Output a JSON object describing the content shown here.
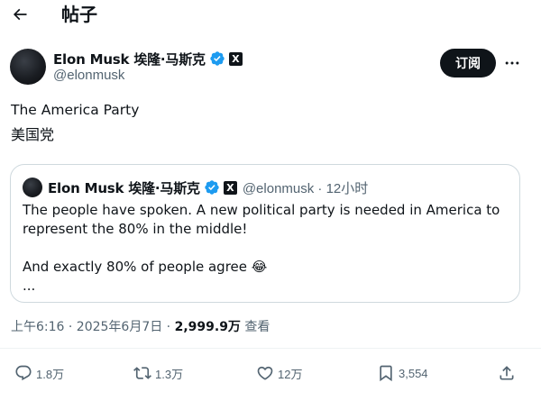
{
  "header": {
    "title": "帖子",
    "back_icon": "arrow-left-icon"
  },
  "author": {
    "name": "Elon Musk 埃隆·马斯克",
    "handle": "@elonmusk",
    "verified_color": "#1d9bf0",
    "affiliate_badge": "X"
  },
  "follow_label": "订阅",
  "post": {
    "line1": "The America Party",
    "line2": "美国党"
  },
  "quote": {
    "name": "Elon Musk 埃隆·马斯克",
    "meta": "@elonmusk · 12小时",
    "line1": "The people have spoken. A new political party is needed in America to",
    "line2": "represent the 80% in the middle!",
    "line3": "And exactly 80% of people agree 😂",
    "line4": "..."
  },
  "timestamp": {
    "time": "上午6:16 · 2025年6月7日 · ",
    "views": "2,999.9万",
    "views_label": " 查看"
  },
  "actions": {
    "reply_count": "1.8万",
    "repost_count": "1.3万",
    "like_count": "12万",
    "bookmark_count": "3,554"
  },
  "colors": {
    "text": "#0f1419",
    "secondary": "#536471",
    "accent": "#1d9bf0",
    "border": "#cfd9de"
  }
}
